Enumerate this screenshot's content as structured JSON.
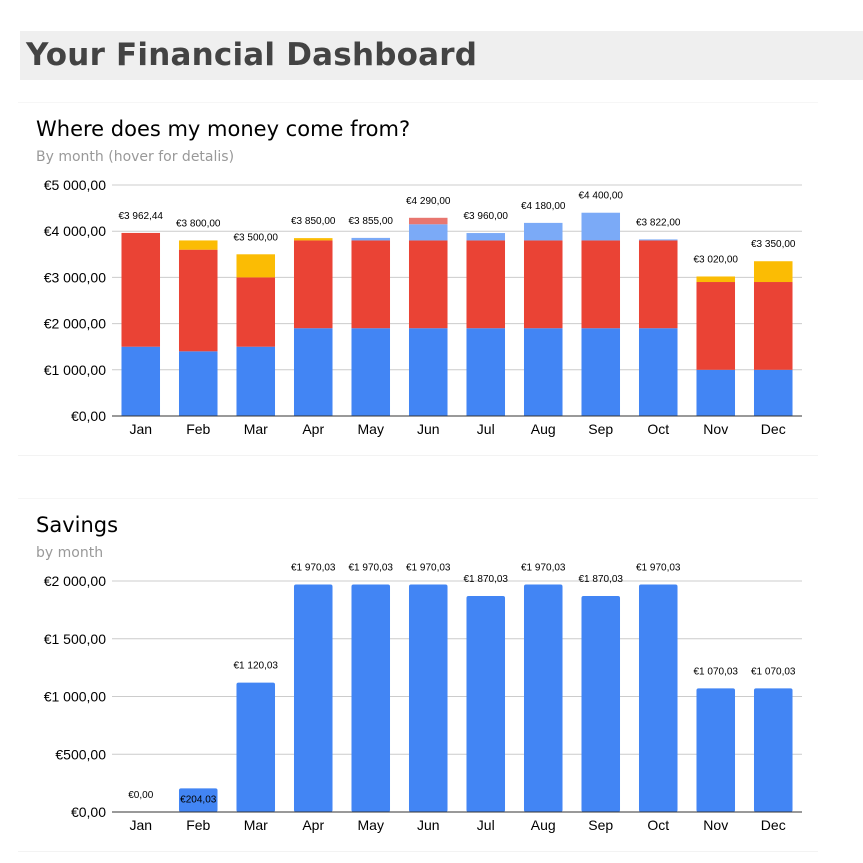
{
  "header": {
    "title": "Your Financial Dashboard"
  },
  "colors": {
    "blue": "#4285f4",
    "red": "#ea4335",
    "yellow": "#fbbc04",
    "light_blue": "#7baaf7",
    "light_red": "#e8766f",
    "grid": "#cccccc",
    "axis": "#333333"
  },
  "chart_data": [
    {
      "type": "bar",
      "stacked": true,
      "title": "Where does my money come from?",
      "subtitle": "By month (hover for detalis)",
      "categories": [
        "Jan",
        "Feb",
        "Mar",
        "Apr",
        "May",
        "Jun",
        "Jul",
        "Aug",
        "Sep",
        "Oct",
        "Nov",
        "Dec"
      ],
      "series": [
        {
          "values": [
            1500,
            1400,
            1500,
            1900,
            1900,
            1900,
            1900,
            1900,
            1900,
            1900,
            1000,
            1000
          ],
          "color": "#4285f4"
        },
        {
          "values": [
            2462.44,
            2200,
            1500,
            1900,
            1900,
            1900,
            1900,
            1900,
            1900,
            1900,
            1900,
            1900
          ],
          "color": "#ea4335"
        },
        {
          "values": [
            0,
            200,
            500,
            50,
            0,
            0,
            0,
            0,
            0,
            0,
            120,
            450
          ],
          "color": "#fbbc04"
        },
        {
          "values": [
            0,
            0,
            0,
            0,
            55,
            350,
            160,
            380,
            600,
            22,
            0,
            0
          ],
          "color": "#7baaf7"
        },
        {
          "values": [
            0,
            0,
            0,
            0,
            0,
            140,
            0,
            0,
            0,
            0,
            0,
            0
          ],
          "color": "#e8766f"
        }
      ],
      "totals": [
        "€3 962,44",
        "€3 800,00",
        "€3 500,00",
        "€3 850,00",
        "€3 855,00",
        "€4 290,00",
        "€3 960,00",
        "€4 180,00",
        "€4 400,00",
        "€3 822,00",
        "€3 020,00",
        "€3 350,00"
      ],
      "ylim": [
        0,
        5000
      ],
      "yticks": [
        0,
        1000,
        2000,
        3000,
        4000,
        5000
      ],
      "ytick_labels": [
        "€0,00",
        "€1 000,00",
        "€2 000,00",
        "€3 000,00",
        "€4 000,00",
        "€5 000,00"
      ],
      "grid": true,
      "xlabel": "",
      "ylabel": ""
    },
    {
      "type": "bar",
      "title": "Savings",
      "subtitle": "by month",
      "categories": [
        "Jan",
        "Feb",
        "Mar",
        "Apr",
        "May",
        "Jun",
        "Jul",
        "Aug",
        "Sep",
        "Oct",
        "Nov",
        "Dec"
      ],
      "values": [
        0,
        204.03,
        1120.03,
        1970.03,
        1970.03,
        1970.03,
        1870.03,
        1970.03,
        1870.03,
        1970.03,
        1070.03,
        1070.03
      ],
      "data_labels": [
        "€0,00",
        "€204,03",
        "€1 120,03",
        "€1 970,03",
        "€1 970,03",
        "€1 970,03",
        "€1 870,03",
        "€1 970,03",
        "€1 870,03",
        "€1 970,03",
        "€1 070,03",
        "€1 070,03"
      ],
      "color": "#4285f4",
      "ylim": [
        0,
        2000
      ],
      "yticks": [
        0,
        500,
        1000,
        1500,
        2000
      ],
      "ytick_labels": [
        "€0,00",
        "€500,00",
        "€1 000,00",
        "€1 500,00",
        "€2 000,00"
      ],
      "grid": true,
      "xlabel": "",
      "ylabel": ""
    }
  ]
}
